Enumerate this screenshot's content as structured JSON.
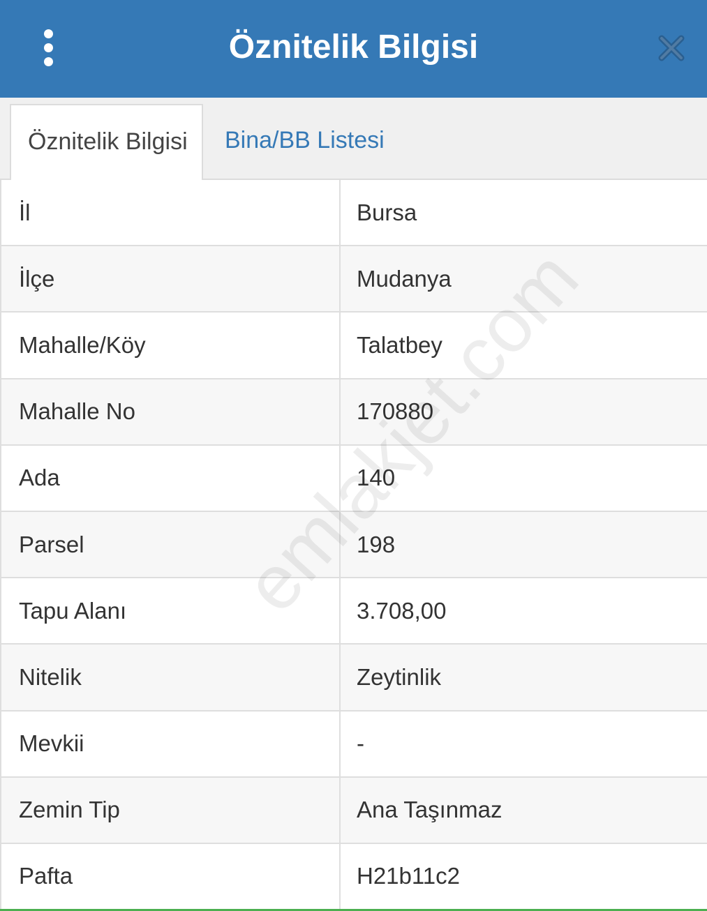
{
  "header": {
    "title": "Öznitelik Bilgisi",
    "menu_icon": "more-vertical-icon",
    "close_icon": "close-icon",
    "background": "#3579b6"
  },
  "tabs": [
    {
      "label": "Öznitelik Bilgisi",
      "active": true
    },
    {
      "label": "Bina/BB Listesi",
      "active": false
    }
  ],
  "rows": [
    {
      "key": "İl",
      "value": "Bursa"
    },
    {
      "key": "İlçe",
      "value": "Mudanya"
    },
    {
      "key": "Mahalle/Köy",
      "value": "Talatbey"
    },
    {
      "key": "Mahalle No",
      "value": "170880"
    },
    {
      "key": "Ada",
      "value": "140"
    },
    {
      "key": "Parsel",
      "value": "198"
    },
    {
      "key": "Tapu Alanı",
      "value": "3.708,00"
    },
    {
      "key": "Nitelik",
      "value": "Zeytinlik"
    },
    {
      "key": "Mevkii",
      "value": "-"
    },
    {
      "key": "Zemin Tip",
      "value": "Ana Taşınmaz"
    },
    {
      "key": "Pafta",
      "value": "H21b11c2"
    }
  ],
  "watermark": "emlakjet.com"
}
